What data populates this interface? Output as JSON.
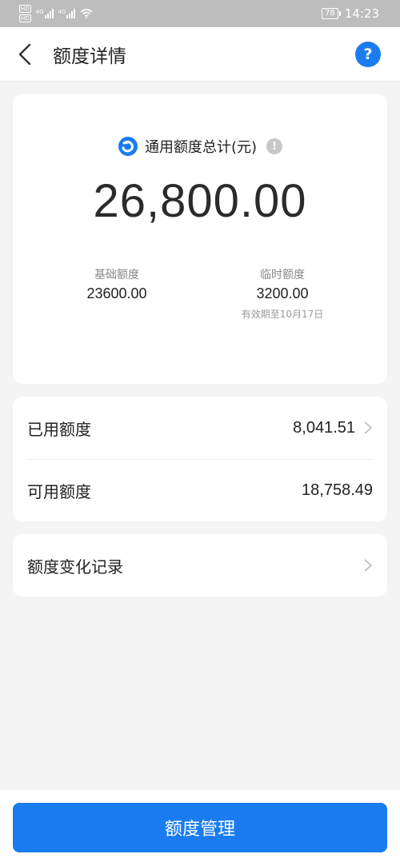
{
  "status_bar": {
    "hd_top": "HD",
    "hd_bottom": "HD",
    "net_a": "4G",
    "net_b": "4G",
    "battery": "78",
    "time": "14:23"
  },
  "nav": {
    "title": "额度详情",
    "help_label": "?"
  },
  "summary": {
    "label": "通用额度总计(元)",
    "info_label": "!",
    "total": "26,800.00",
    "base": {
      "label": "基础额度",
      "value": "23600.00"
    },
    "temp": {
      "label": "临时额度",
      "value": "3200.00",
      "note": "有效期至10月17日"
    }
  },
  "rows": [
    {
      "label": "已用额度",
      "value": "8,041.51",
      "has_chevron": true
    },
    {
      "label": "可用额度",
      "value": "18,758.49",
      "has_chevron": false
    }
  ],
  "history": {
    "label": "额度变化记录"
  },
  "bottom": {
    "button_label": "额度管理"
  },
  "colors": {
    "accent": "#1a7cf0",
    "status_bar": "#bdbdbd",
    "background": "#f4f4f4"
  }
}
